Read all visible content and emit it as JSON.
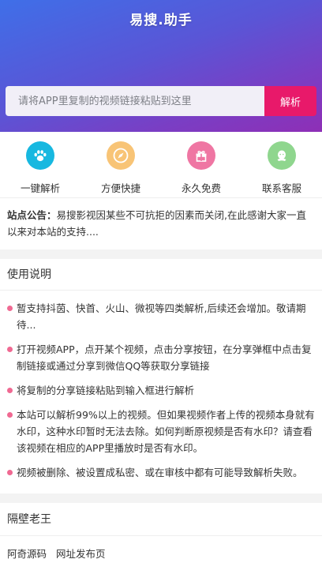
{
  "header": {
    "logo_text": "易搜.助手"
  },
  "search": {
    "placeholder": "请将APP里复制的视频链接粘贴到这里",
    "value": "",
    "button_label": "解析"
  },
  "features": [
    {
      "label": "一键解析",
      "icon": "paw-icon",
      "color": "#17b8e0"
    },
    {
      "label": "方便快捷",
      "icon": "compass-icon",
      "color": "#f8c476"
    },
    {
      "label": "永久免费",
      "icon": "gift-icon",
      "color": "#ef76a3"
    },
    {
      "label": "联系客服",
      "icon": "support-icon",
      "color": "#8fd68e"
    }
  ],
  "notice": {
    "prefix": "站点公告：",
    "text": "易搜影视因某些不可抗拒的因素而关闭,在此感谢大家一直以来对本站的支持...."
  },
  "instructions": {
    "title": "使用说明",
    "items": [
      "暂支持抖茵、快首、火山、微视等四类解析,后续还会增加。敬请期待...",
      "打开视频APP，点开某个视频，点击分享按钮，在分享弹框中点击复制链接或通过分享到微信QQ等获取分享链接",
      "将复制的分享链接粘贴到输入框进行解析",
      "本站可以解析99%以上的视频。但如果视频作者上传的视频本身就有水印，这种水印暂时无法去除。如何判断原视频是否有水印？请查看该视频在相应的APP里播放时是否有水印。",
      "视频被删除、被设置成私密、或在审核中都有可能导致解析失败。"
    ],
    "bullet_color": "#f06992"
  },
  "footer": {
    "title": "隔壁老王",
    "links": [
      "阿奇源码",
      "网址发布页"
    ]
  },
  "colors": {
    "accent": "#e8196a",
    "hero_start": "#3f6fe8",
    "hero_end": "#8e2fb6"
  }
}
